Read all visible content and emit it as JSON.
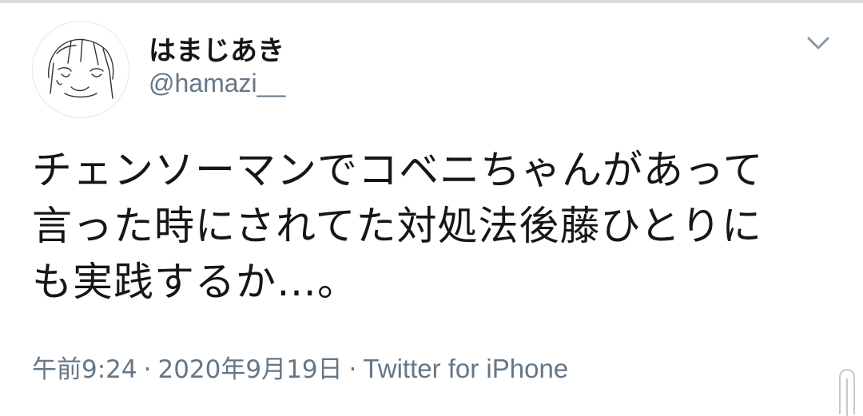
{
  "tweet": {
    "author": {
      "display_name": "はまじあき",
      "handle": "@hamazi__",
      "avatar_icon": "avatar-sketch-icon"
    },
    "text_lines": [
      "チェンソーマンでコベニちゃんがあって",
      "言った時にされてた対処法後藤ひとりに",
      "も実践するか…。"
    ],
    "meta": {
      "time": "午前9:24",
      "separator": "·",
      "date": "2020年9月19日",
      "source": "Twitter for iPhone"
    },
    "menu_icon": "chevron-down-icon"
  },
  "colors": {
    "text_primary": "#14171a",
    "text_secondary": "#657786",
    "divider": "#d9dde2"
  }
}
